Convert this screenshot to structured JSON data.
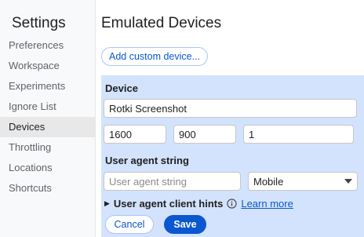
{
  "sidebar": {
    "title": "Settings",
    "items": [
      {
        "label": "Preferences"
      },
      {
        "label": "Workspace"
      },
      {
        "label": "Experiments"
      },
      {
        "label": "Ignore List"
      },
      {
        "label": "Devices"
      },
      {
        "label": "Throttling"
      },
      {
        "label": "Locations"
      },
      {
        "label": "Shortcuts"
      }
    ],
    "selected": "Devices"
  },
  "main": {
    "title": "Emulated Devices",
    "add_button_label": "Add custom device...",
    "device": {
      "section_label": "Device",
      "name_value": "Rotki Screenshot",
      "width_value": "1600",
      "height_value": "900",
      "scale_value": "1"
    },
    "user_agent": {
      "section_label": "User agent string",
      "input_placeholder": "User agent string",
      "input_value": "",
      "type_selected": "Mobile"
    },
    "client_hints": {
      "label": "User agent client hints",
      "learn_more": "Learn more"
    },
    "actions": {
      "cancel_label": "Cancel",
      "save_label": "Save"
    }
  },
  "colors": {
    "accent": "#0b57d0",
    "panel_bg": "#d3e3fd",
    "sidebar_bg": "#f8f9fb",
    "selected_bg": "#e8e8e8"
  }
}
